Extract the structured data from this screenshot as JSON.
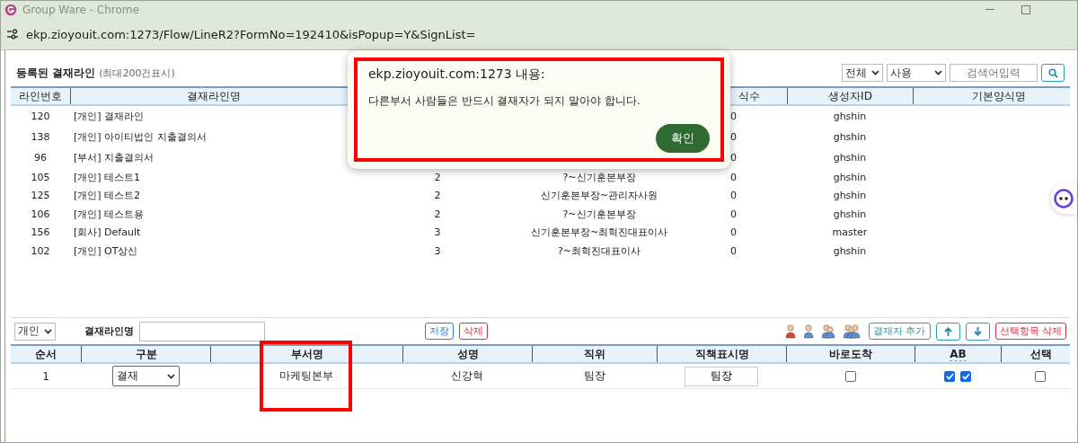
{
  "window": {
    "title": "Group Ware - Chrome"
  },
  "address_bar": {
    "url": "ekp.zioyouit.com:1273/Flow/LineR2?FormNo=192410&isPopup=Y&SignList="
  },
  "line_list": {
    "title": "등록된 결재라인",
    "note": "(최대200건표시)",
    "filters": [
      {
        "value": "전체"
      },
      {
        "value": "사용"
      }
    ],
    "search": {
      "placeholder": "검색어입력"
    },
    "columns": [
      {
        "label": "라인번호"
      },
      {
        "label": "결재라인명"
      },
      {},
      {},
      {
        "label": "식수"
      },
      {
        "label": "생성자ID"
      },
      {
        "label": "기본양식명"
      }
    ],
    "rows": [
      {
        "no": "120",
        "name": "[개인] 결재라인",
        "column_5": "0",
        "creator": "ghshin"
      },
      {
        "no": "138",
        "name": "[개인] 아이티법인 지출결의서",
        "column_5": "0",
        "creator": "ghshin"
      },
      {
        "no": "96",
        "name": "[부서] 지출결의서",
        "column_5": "0",
        "creator": "ghshin"
      },
      {
        "no": "105",
        "name": "[개인] 테스트1",
        "column_3": "2",
        "column_4": "?~신기훈본부장",
        "column_5": "0",
        "creator": "ghshin"
      },
      {
        "no": "125",
        "name": "[개인] 테스트2",
        "column_3": "2",
        "column_4": "신기훈본부장~관리자사원",
        "column_5": "0",
        "creator": "ghshin"
      },
      {
        "no": "106",
        "name": "[개인] 테스트용",
        "column_3": "2",
        "column_4": "?~신기훈본부장",
        "column_5": "0",
        "creator": "ghshin"
      },
      {
        "no": "156",
        "name": "[회사] Default",
        "column_3": "3",
        "column_4": "신기훈본부장~최혁진대표이사",
        "column_5": "0",
        "creator": "master"
      },
      {
        "no": "102",
        "name": "[개인] OT상신",
        "column_3": "3",
        "column_4": "?~최혁진대표이사",
        "column_5": "0",
        "creator": "ghshin"
      }
    ]
  },
  "dialog": {
    "origin": "ekp.zioyouit.com:1273 내용:",
    "message": "다른부서 사람들은 반드시 결재자가 되지 말아야 합니다.",
    "button": "확인"
  },
  "editor": {
    "type_select": "개인",
    "name_label": "결재라인명",
    "buttons": [
      {
        "label": "저장",
        "kind": "primary"
      },
      {
        "label": "삭제",
        "kind": "danger"
      }
    ],
    "tools": [
      {
        "kind": "add",
        "label": "결재자 추가"
      },
      {
        "kind": "up"
      },
      {
        "kind": "down"
      },
      {
        "kind": "danger",
        "label": "선택항목 삭제"
      }
    ],
    "columns": [
      {
        "label": "순서",
        "highlighted": false
      },
      {
        "label": "구분",
        "highlighted": false
      },
      {
        "label": "부서명",
        "highlighted": true
      },
      {
        "label": "성명",
        "highlighted": false
      },
      {
        "label": "직위",
        "highlighted": false
      },
      {
        "label": "직책표시명",
        "highlighted": false
      },
      {
        "label": "바로도착",
        "highlighted": false
      },
      {
        "label": "AB",
        "highlighted": false
      },
      {
        "label": "선택",
        "highlighted": false
      }
    ],
    "rows": [
      {
        "order": "1",
        "type": "결재",
        "dept": "마케팅본부",
        "name": "신강혁",
        "position": "팀장",
        "title_display": "팀장",
        "direct": false,
        "ab": [
          true,
          true
        ],
        "selected": false
      }
    ]
  }
}
